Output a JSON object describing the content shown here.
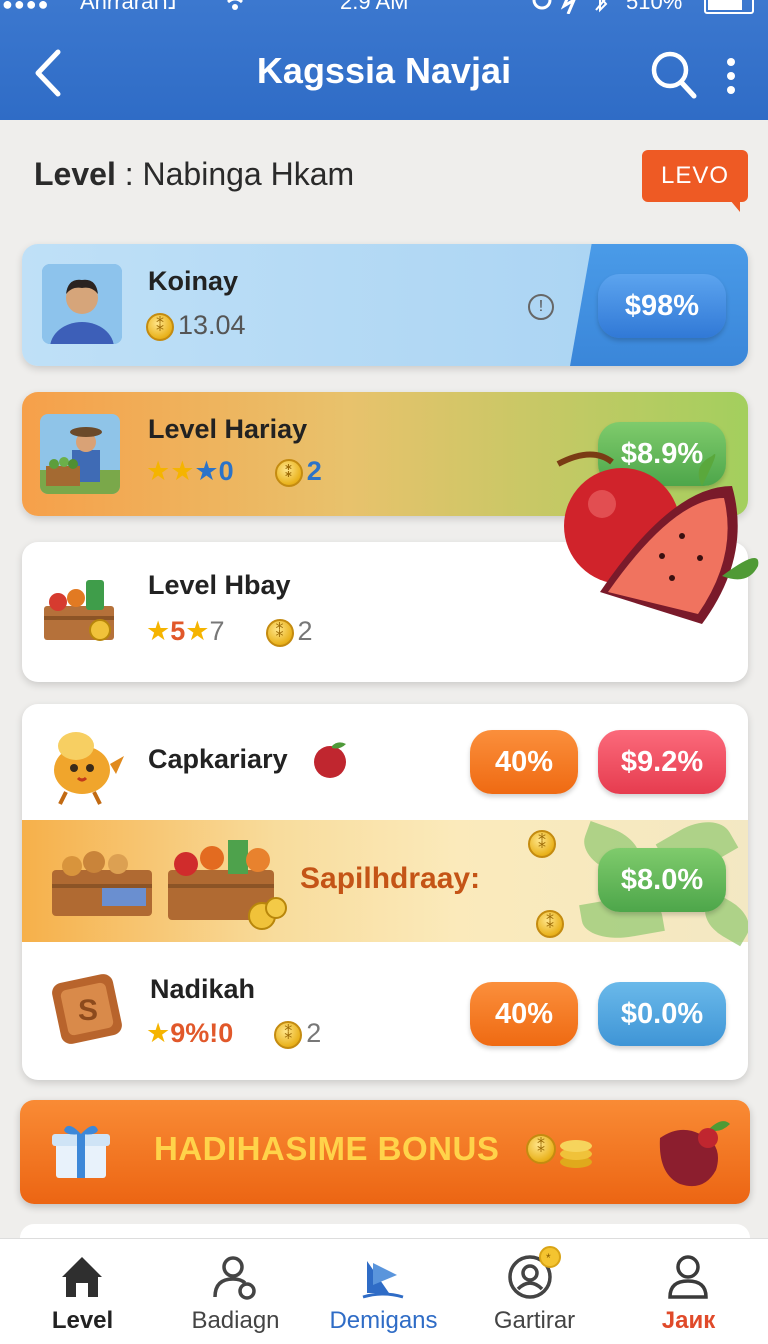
{
  "status_bar": {
    "signal": "●●●●",
    "carrier": "Anrraraנח",
    "time": "2:9 AM",
    "battery": "510%"
  },
  "header": {
    "title": "Kagssia Navjai",
    "back_icon": "chevron-left-icon",
    "search_icon": "search-icon",
    "more_icon": "more-vertical-icon"
  },
  "level_header": {
    "label": "Level",
    "separator": " : ",
    "value": "Nabinga Hkam",
    "badge": "LEVO"
  },
  "cards": [
    {
      "name": "Koinay",
      "coin_value": "13.04",
      "button": "$98%",
      "info_icon": "info-icon",
      "accent": "#3a86d9"
    },
    {
      "name": "Level Hariay",
      "stars_text": "0",
      "coins": "2",
      "button": "$8.9%",
      "accent": "#4da64a"
    },
    {
      "name": "Level Hbay",
      "stars_a": "5",
      "stars_b": "7",
      "coins": "2"
    }
  ],
  "capkariary": {
    "name": "Capkariary",
    "pill_left": "40%",
    "pill_right": "$9.2%"
  },
  "promo": {
    "text": "Sapilhdraay:",
    "button": "$8.0%"
  },
  "nadikah": {
    "name": "Nadikah",
    "stars_text": "9%!0",
    "coins": "2",
    "pill_left": "40%",
    "pill_right": "$0.0%"
  },
  "bonus": {
    "text": "HADIHASIME BONUS",
    "gift_icon": "gift-icon"
  },
  "bottom_nav": [
    {
      "label": "Level",
      "icon": "home-icon",
      "color": "#222222"
    },
    {
      "label": "Badiagn",
      "icon": "user-lock-icon",
      "color": "#444444"
    },
    {
      "label": "Demigans",
      "icon": "sail-icon",
      "color": "#2f6cc6"
    },
    {
      "label": "Gartirar",
      "icon": "user-circle-icon",
      "color": "#444444"
    },
    {
      "label": "Jaик",
      "icon": "profile-icon",
      "color": "#e04a2a"
    }
  ]
}
